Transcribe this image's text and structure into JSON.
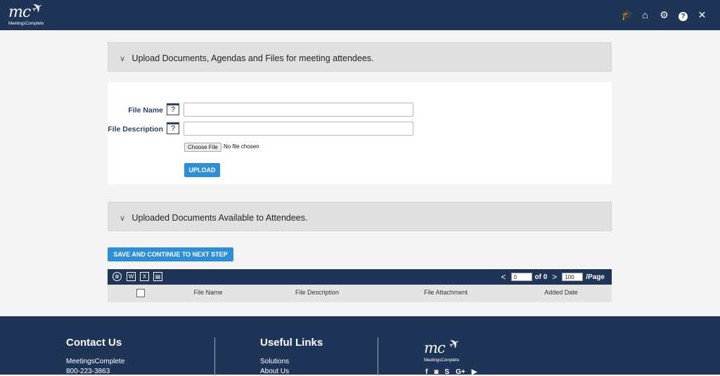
{
  "header": {
    "logo_text": "mc",
    "logo_tagline": "MeetingsComplete",
    "icons": [
      "graduation-cap-icon",
      "home-icon",
      "gear-icon",
      "help-icon",
      "close-icon"
    ]
  },
  "upload_panel": {
    "title": "Upload Documents, Agendas and Files for meeting attendees."
  },
  "form": {
    "file_name_label": "File Name",
    "file_description_label": "File Description",
    "help_glyph": "?",
    "file_name_value": "",
    "file_description_value": "",
    "choose_file_label": "Choose File",
    "no_file_text": "No file chosen",
    "upload_label": "UPLOAD"
  },
  "uploaded_panel": {
    "title": "Uploaded Documents Available to Attendees."
  },
  "save_button_label": "SAVE AND CONTINUE TO NEXT STEP",
  "grid": {
    "tools": [
      "clear-filter-icon",
      "word-export-icon",
      "excel-export-icon",
      "print-icon"
    ],
    "tool_glyphs": [
      "⊗",
      "W",
      "X",
      "▤"
    ],
    "page_value": "0",
    "of_text": "of 0",
    "page_size": "100",
    "per_page_text": "/Page",
    "columns": [
      "File Name",
      "File Description",
      "File Attachment",
      "Added Date"
    ]
  },
  "footer": {
    "contact_heading": "Contact Us",
    "contact_company": "MeetingsComplete",
    "contact_phone": "800-223-3863",
    "links_heading": "Useful Links",
    "links": [
      "Solutions",
      "About Us"
    ],
    "logo_text": "mc",
    "logo_tagline": "MeetingsComplete",
    "social_glyphs": [
      "f",
      "◙",
      "S",
      "G+",
      "▶"
    ],
    "social_icons": [
      "facebook-icon",
      "instagram-icon",
      "skype-icon",
      "google-plus-icon",
      "youtube-icon"
    ]
  }
}
